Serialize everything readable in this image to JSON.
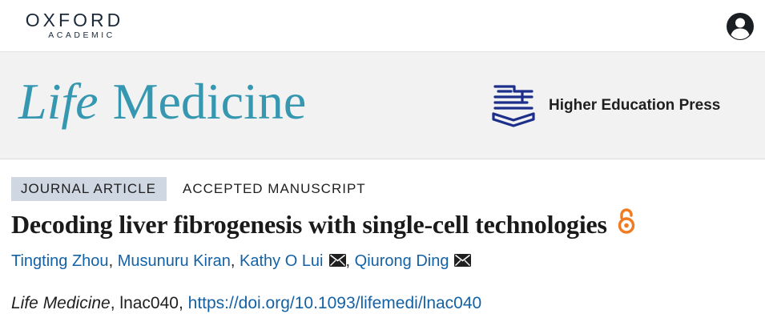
{
  "header": {
    "logo_line1": "OXFORD",
    "logo_line2": "ACADEMIC",
    "account_icon": "user-account-icon"
  },
  "banner": {
    "journal_title_italic": "Life",
    "journal_title_rest": "Medicine",
    "journal_color": "#3597b0",
    "publisher_logo_icon": "hep-logo-icon",
    "publisher_name": "Higher Education Press",
    "publisher_color": "#1c2f8a"
  },
  "article": {
    "type_badge": "JOURNAL ARTICLE",
    "status": "ACCEPTED MANUSCRIPT",
    "title": "Decoding liver fibrogenesis with single-cell technologies",
    "open_access_icon": "open-access-icon",
    "open_access_color": "#f07b20",
    "authors": [
      {
        "name": "Tingting Zhou",
        "sep": ",",
        "corresponding": false
      },
      {
        "name": "Musunuru Kiran",
        "sep": ",",
        "corresponding": false
      },
      {
        "name": "Kathy O Lui",
        "sep": ",",
        "corresponding": true
      },
      {
        "name": "Qiurong Ding",
        "sep": "",
        "corresponding": true
      }
    ],
    "link_color": "#1462a6",
    "citation": {
      "journal": "Life Medicine",
      "sep1": ", ",
      "article_id": "lnac040",
      "sep2": ", ",
      "doi": "https://doi.org/10.1093/lifemedi/lnac040"
    }
  }
}
